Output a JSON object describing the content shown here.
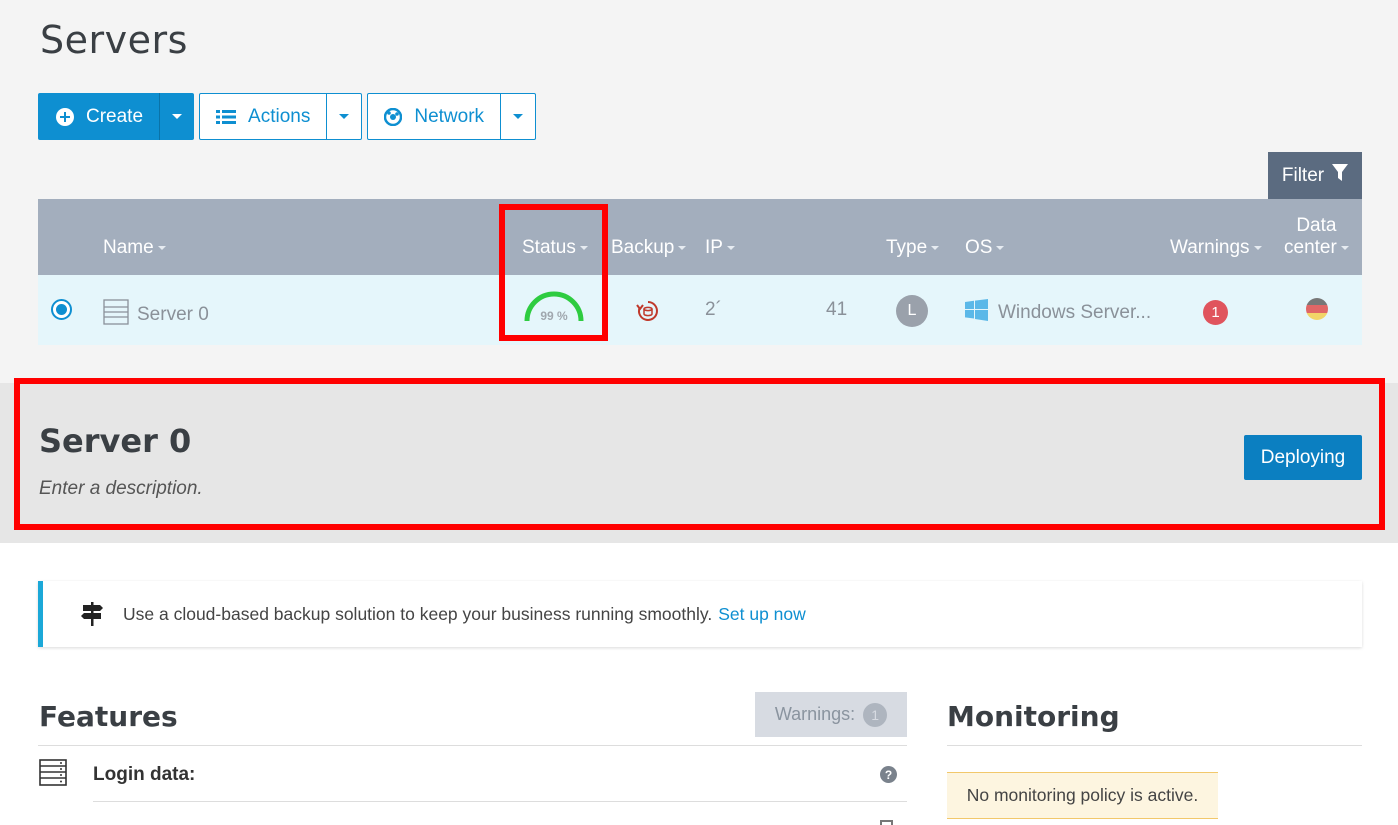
{
  "page": {
    "title": "Servers"
  },
  "toolbar": {
    "create_label": "Create",
    "actions_label": "Actions",
    "network_label": "Network",
    "filter_label": "Filter"
  },
  "table": {
    "columns": {
      "name": "Name",
      "status": "Status",
      "backup": "Backup",
      "ip": "IP",
      "type": "Type",
      "os": "OS",
      "warnings": "Warnings",
      "datacenter_line1": "Data",
      "datacenter_line2": "center"
    },
    "row": {
      "name": "Server 0",
      "status_percent_label": "99 %",
      "status_percent": 99,
      "ip_prefix": "2´",
      "ip_suffix": "41",
      "type_badge": "L",
      "os": "Windows Server...",
      "warnings_count": "1"
    }
  },
  "detail": {
    "title": "Server 0",
    "description": "Enter a description.",
    "status_button": "Deploying"
  },
  "notice": {
    "text": "Use a cloud-based backup solution to keep your business running smoothly.",
    "link": "Set up now"
  },
  "features": {
    "title": "Features",
    "warnings_label": "Warnings:",
    "warnings_count": "1",
    "login_label": "Login data:",
    "help_glyph": "?"
  },
  "monitoring": {
    "title": "Monitoring",
    "note": "No monitoring policy is active."
  },
  "colors": {
    "accent": "#0e8fd1",
    "header_bg": "#a3aebd",
    "row_bg": "#e5f6fb",
    "status_green": "#2ecc40",
    "warning_red": "#e0545d",
    "highlight": "#ff0000"
  }
}
